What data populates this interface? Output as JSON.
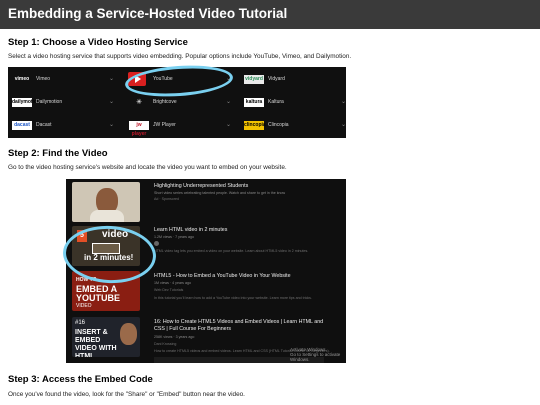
{
  "page": {
    "title": "Embedding a Service-Hosted Video Tutorial"
  },
  "step1": {
    "heading": "Step 1: Choose a Video Hosting Service",
    "text": "Select a video hosting service that supports video embedding. Popular options include YouTube, Vimeo, and Dailymotion.",
    "services": [
      {
        "label": "Vimeo",
        "logo": "vimeo",
        "color": "#ffffff"
      },
      {
        "label": "YouTube",
        "logo": "youtube-icon",
        "color": "#d92020"
      },
      {
        "label": "Vidyard",
        "logo": "vidyard",
        "color": "#2d8f5a"
      },
      {
        "label": "Dailymotion",
        "logo": "dailymotion",
        "color": "#ffffff"
      },
      {
        "label": "Brightcove",
        "logo": "brightcove",
        "color": "#ffffff"
      },
      {
        "label": "Kaltura",
        "logo": "kaltura",
        "color": "#ffffff"
      },
      {
        "label": "Dacast",
        "logo": "dacast",
        "color": "#ffffff"
      },
      {
        "label": "JW Player",
        "logo": "jw player",
        "color": "#ffffff"
      },
      {
        "label": "Clincopia",
        "logo": "clincopia",
        "color": "#f2c200"
      }
    ]
  },
  "step2": {
    "heading": "Step 2: Find the Video",
    "text": "Go to the video hosting service's website and locate the video you want to embed on your website.",
    "videos": [
      {
        "title": "Highlighting Underrepresented Students",
        "meta": "Short video series celebrating talented people. Watch and share to get in the know",
        "channel": "Ad · Sponsored"
      },
      {
        "title": "Learn HTML video in 2 minutes",
        "meta": "1.2M views · 7 years ago",
        "desc": "HTML video tag lets you embed a video on your website. Learn about HTML5 video in 2 minutes.",
        "thumb_top": "video",
        "thumb_bottom": "in 2 minutes!"
      },
      {
        "title": "HTML5 - How to Embed a YouTube Video in Your Website",
        "meta": "1M views · 4 years ago",
        "channel": "Web Dev Tutorials",
        "desc": "In this tutorial you'll learn how to add a YouTube video into your website. Learn more tips and tricks.",
        "thumb_a": "HOW TO",
        "thumb_b": "EMBED A YOUTUBE",
        "thumb_c": "VIDEO"
      },
      {
        "title": "16: How to Create HTML5 Videos and Embed Videos | Learn HTML and CSS | Full Course For Beginners",
        "meta": "258K views · 3 years ago",
        "channel": "Dani Krossing",
        "desc": "How to create HTML5 videos and embed videos. Learn HTML and CSS (HTML Tutorial Course for Beginners).",
        "thumb_num": "#16",
        "thumb_text": "INSERT & EMBED VIDEO WITH HTML"
      }
    ],
    "watermark_line1": "Activate Windows",
    "watermark_line2": "Go to Settings to activate Windows."
  },
  "step3": {
    "heading": "Step 3: Access the Embed Code",
    "text": "Once you've found the video, look for the \"Share\" or \"Embed\" button near the video."
  }
}
